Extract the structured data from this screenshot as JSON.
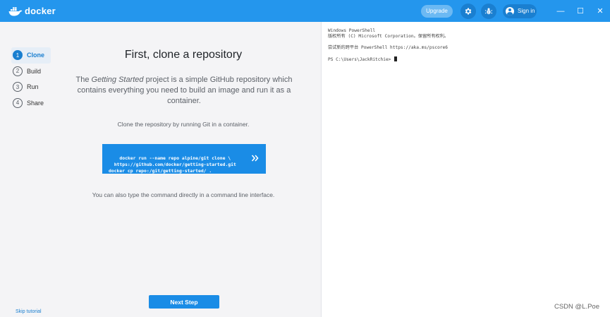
{
  "titlebar": {
    "logo_text": "docker",
    "upgrade_label": "Upgrade",
    "signin_label": "Sign in",
    "icons": {
      "settings": "gear-icon",
      "bug": "bug-icon",
      "account": "account-icon"
    },
    "window_controls": {
      "minimize": "—",
      "maximize": "☐",
      "close": "✕"
    }
  },
  "steps": [
    {
      "number": "1",
      "label": "Clone",
      "active": true
    },
    {
      "number": "2",
      "label": "Build",
      "active": false
    },
    {
      "number": "3",
      "label": "Run",
      "active": false
    },
    {
      "number": "4",
      "label": "Share",
      "active": false
    }
  ],
  "main": {
    "heading": "First, clone a repository",
    "desc_prefix": "The ",
    "desc_italic": "Getting Started",
    "desc_suffix": " project is a simple GitHub repository which contains everything you need to build an image and run it as a container.",
    "instruction": "Clone the repository by running Git in a container.",
    "command": "docker run --name repo alpine/git clone \\\n  https://github.com/docker/getting-started.git\ndocker cp repo:/git/getting-started/ .",
    "alt_text": "You can also type the command directly in a command line interface.",
    "next_label": "Next Step",
    "skip_label": "Skip tutorial"
  },
  "terminal": {
    "text": "Windows PowerShell\n版权所有 (C) Microsoft Corporation。保留所有权利。\n\n尝试新的跨平台 PowerShell https://aka.ms/pscore6\n\nPS C:\\Users\\JackRitchie> "
  },
  "watermark": "CSDN @L.Poe",
  "colors": {
    "accent": "#2496ed",
    "button": "#1a8ce6",
    "panel": "#f4f4f6"
  }
}
